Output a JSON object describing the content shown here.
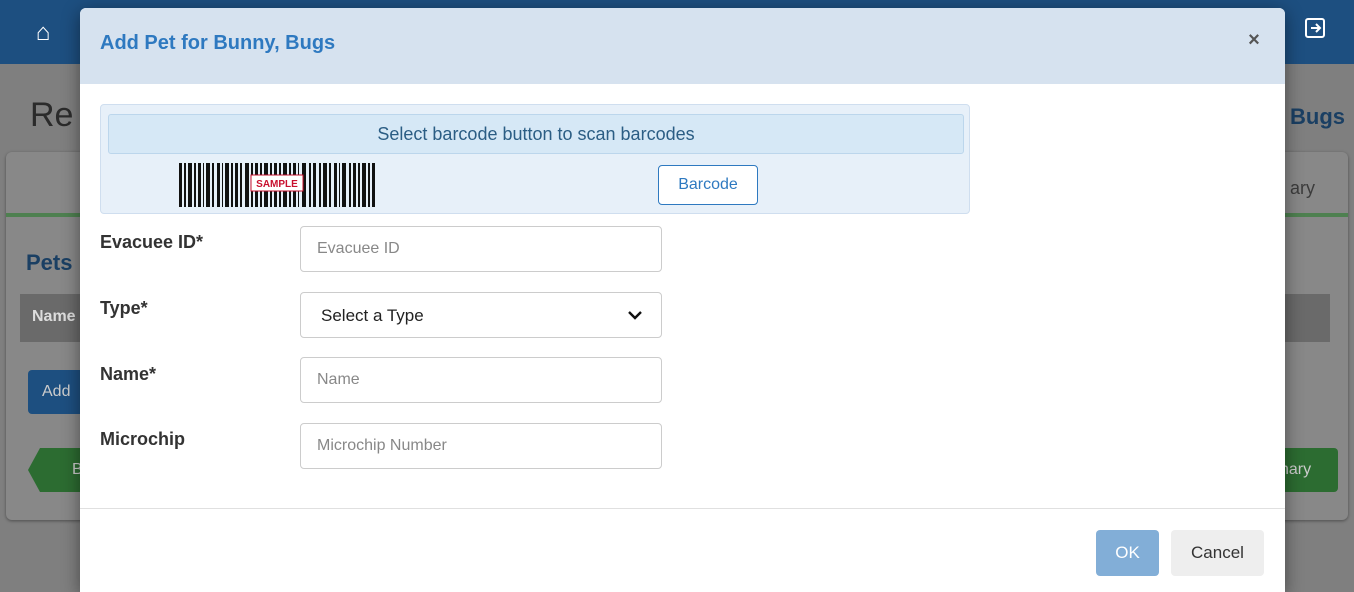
{
  "background": {
    "home_icon": "home-icon",
    "exit_icon": "exit-icon",
    "title_partial": "Re",
    "right_title_partial": "Bugs",
    "right_tab_partial": "ary",
    "pets_heading_partial": "Pets",
    "table_header_partial": "Name",
    "add_button_partial": "Add",
    "back_button_partial": "B",
    "summary_button_partial": "nary"
  },
  "modal": {
    "title": "Add Pet for Bunny, Bugs",
    "close_label": "×",
    "barcode": {
      "info_text": "Select barcode button to scan barcodes",
      "sample_label": "SAMPLE",
      "button_label": "Barcode"
    },
    "fields": {
      "evacuee_id": {
        "label": "Evacuee ID*",
        "placeholder": "Evacuee ID",
        "value": ""
      },
      "type": {
        "label": "Type*",
        "selected": "Select a Type"
      },
      "name": {
        "label": "Name*",
        "placeholder": "Name",
        "value": ""
      },
      "microchip": {
        "label": "Microchip",
        "placeholder": "Microchip Number",
        "value": ""
      }
    },
    "footer": {
      "ok_label": "OK",
      "cancel_label": "Cancel"
    }
  },
  "colors": {
    "header_blue": "#1d4f80",
    "modal_title": "#2e79c0",
    "ok_button": "#82aed7"
  }
}
